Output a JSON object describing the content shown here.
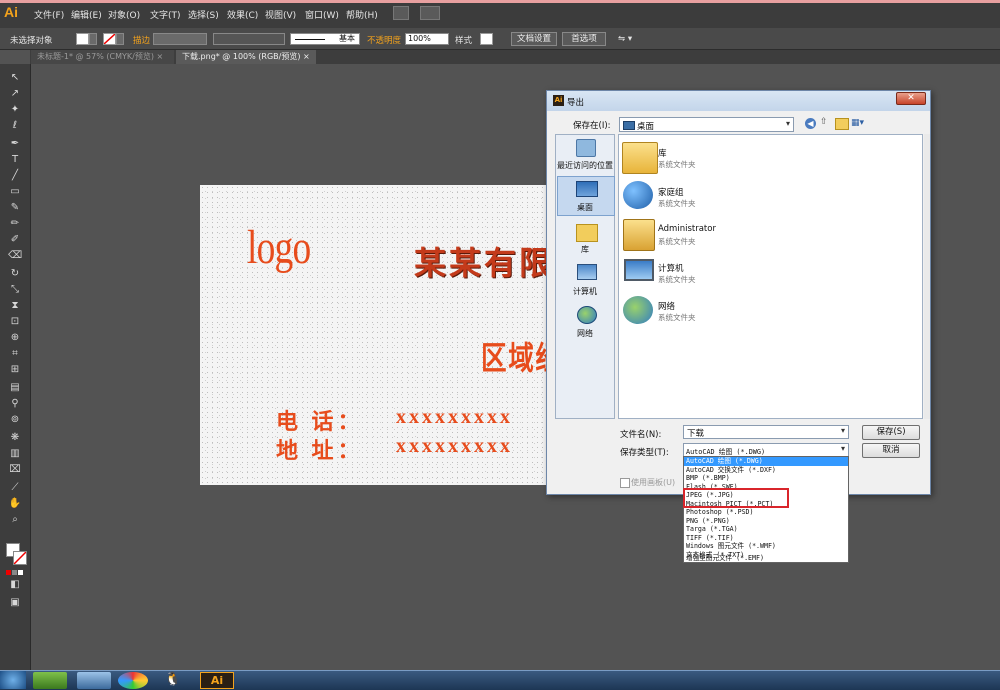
{
  "app": {
    "logo": "Ai"
  },
  "menus": [
    "文件(F)",
    "编辑(E)",
    "对象(O)",
    "文字(T)",
    "选择(S)",
    "效果(C)",
    "视图(V)",
    "窗口(W)",
    "帮助(H)"
  ],
  "control": {
    "selection": "未选择对象",
    "stroke_label": "描边",
    "stroke_style": "基本",
    "opacity_label": "不透明度",
    "opacity_value": "100%",
    "style_label": "样式",
    "doc_settings": "文档设置",
    "preferences": "首选项"
  },
  "tabs": [
    {
      "label": "未标题-1* @ 57% (CMYK/预览)",
      "active": false
    },
    {
      "label": "下载.png* @ 100% (RGB/预览)",
      "active": true
    }
  ],
  "card": {
    "logo": "logo",
    "company": "某某有限",
    "region": "区域经",
    "phone_label": "电 话：",
    "phone_value": "xxxxxxxxx",
    "address_label": "地 址：",
    "address_value": "xxxxxxxxx"
  },
  "dialog": {
    "title": "导出",
    "save_in_label": "保存在(I):",
    "save_in_value": "桌面",
    "nav": [
      {
        "label": "最近访问的位置",
        "icon": "recent-places-icon"
      },
      {
        "label": "桌面",
        "icon": "desktop-icon"
      },
      {
        "label": "库",
        "icon": "library-icon"
      },
      {
        "label": "计算机",
        "icon": "computer-icon"
      },
      {
        "label": "网络",
        "icon": "network-icon"
      }
    ],
    "files": [
      {
        "name": "库",
        "type": "系统文件夹",
        "icon": "library-folder-icon"
      },
      {
        "name": "家庭组",
        "type": "系统文件夹",
        "icon": "homegroup-icon"
      },
      {
        "name": "Administrator",
        "type": "系统文件夹",
        "icon": "user-folder-icon"
      },
      {
        "name": "计算机",
        "type": "系统文件夹",
        "icon": "computer-icon"
      },
      {
        "name": "网络",
        "type": "系统文件夹",
        "icon": "network-icon"
      }
    ],
    "filename_label": "文件名(N):",
    "filename_value": "下载",
    "filetype_label": "保存类型(T):",
    "filetype_value": "AutoCAD 绘图 (*.DWG)",
    "use_artboards": "使用画板(U)",
    "save_button": "保存(S)",
    "cancel_button": "取消",
    "filetype_options": [
      "AutoCAD 绘图 (*.DWG)",
      "AutoCAD 交换文件 (*.DXF)",
      "BMP (*.BMP)",
      "Flash (*.SWF)",
      "JPEG (*.JPG)",
      "Macintosh PICT (*.PCT)",
      "Photoshop (*.PSD)",
      "PNG (*.PNG)",
      "Targa (*.TGA)",
      "TIFF (*.TIF)",
      "Windows 图元文件 (*.WMF)",
      "文本格式 (*.TXT)",
      "增强型图元文件 (*.EMF)"
    ],
    "selected_option": 0,
    "highlighted_options": [
      4,
      5
    ]
  },
  "taskbar": {
    "ai_label": "Ai"
  },
  "colors": {
    "accent_orange": "#f3a21c",
    "card_red": "#e74c1c",
    "highlight_red": "#d9252b",
    "selection_blue": "#3399ff"
  }
}
